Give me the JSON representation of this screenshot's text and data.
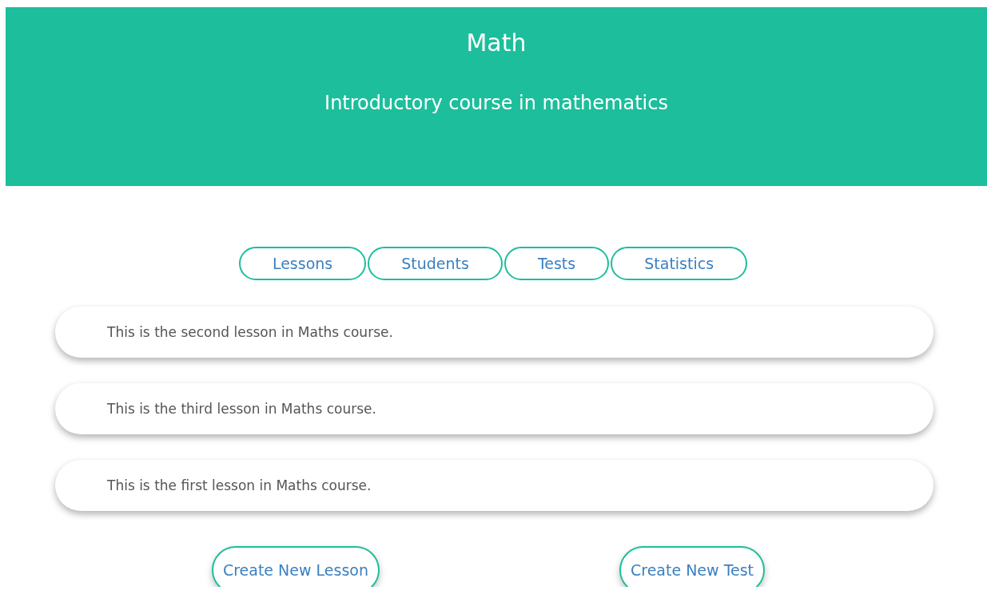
{
  "header": {
    "title": "Math",
    "subtitle": "Introductory course in mathematics"
  },
  "tabs": [
    {
      "label": "Lessons",
      "selected": false
    },
    {
      "label": "Students",
      "selected": false
    },
    {
      "label": "Tests",
      "selected": false
    },
    {
      "label": "Statistics",
      "selected": false
    }
  ],
  "lessons": [
    {
      "text": "This is the second lesson in Maths course."
    },
    {
      "text": "This is the third lesson in Maths course."
    },
    {
      "text": "This is the first lesson in Maths course."
    }
  ],
  "buttons": [
    "Create New Lesson",
    "Create New Test"
  ]
}
